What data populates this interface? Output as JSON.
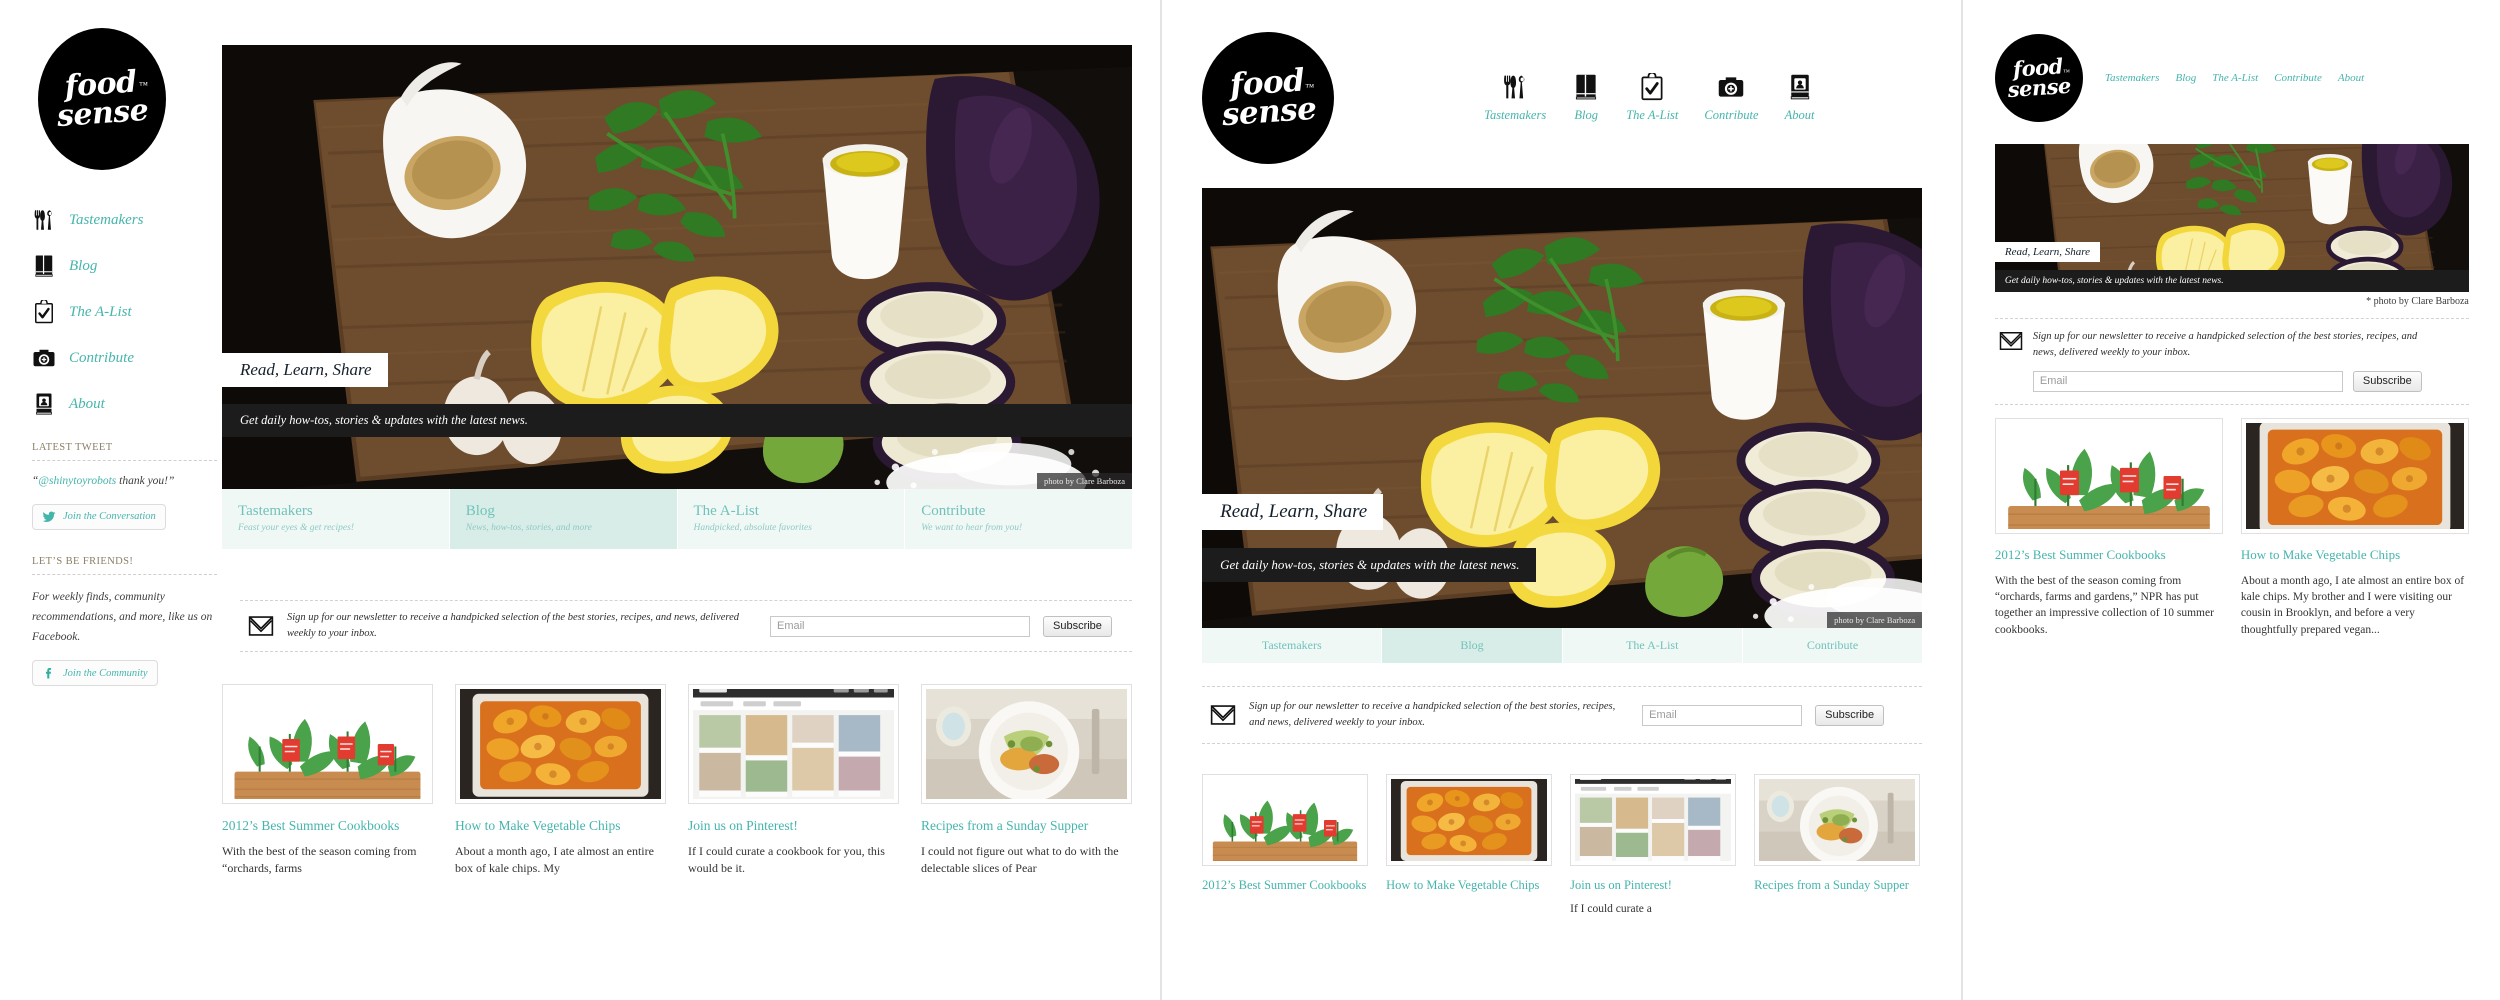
{
  "brand": {
    "line1": "food",
    "line2": "sense",
    "tm": "™"
  },
  "nav": {
    "items": [
      {
        "label": "Tastemakers",
        "icon": "utensils-icon"
      },
      {
        "label": "Blog",
        "icon": "book-icon"
      },
      {
        "label": "The A-List",
        "icon": "clipboard-check-icon"
      },
      {
        "label": "Contribute",
        "icon": "camera-icon"
      },
      {
        "label": "About",
        "icon": "profile-book-icon"
      }
    ]
  },
  "sidebar": {
    "tweet_heading": "LATEST TWEET",
    "tweet_handle": "@shinytoyrobots",
    "tweet_text_before": "“",
    "tweet_text_after": " thank you!”",
    "tweet_button": "Join the Conversation",
    "friends_heading": "LET’S BE FRIENDS!",
    "friends_text": "For weekly finds, community recommendations, and more, like us on Facebook.",
    "friends_button": "Join the Community"
  },
  "hero": {
    "title": "Read, Learn, Share",
    "subtitle": "Get daily how-tos, stories & updates with the latest news.",
    "credit_inset": "photo by Clare Barboza",
    "credit_line": "* photo by Clare Barboza"
  },
  "tabs": [
    {
      "title": "Tastemakers",
      "sub": "Feast your eyes & get recipes!",
      "active": false
    },
    {
      "title": "Blog",
      "sub": "News, how-tos, stories, and more",
      "active": true
    },
    {
      "title": "The A-List",
      "sub": "Handpicked, absolute favorites",
      "active": false
    },
    {
      "title": "Contribute",
      "sub": "We want to hear from you!",
      "active": false
    }
  ],
  "newsletter": {
    "text_desktop": "Sign up for our newsletter to receive a handpicked selection of the best stories, recipes, and news, delivered weekly to your inbox.",
    "text_tablet": "Sign up for our newsletter to receive a handpicked selection of the best stories, recipes, and news, delivered weekly to your inbox.",
    "text_mobile": "Sign up for our newsletter to receive a handpicked selection of the best stories, recipes, and news, delivered weekly to your inbox.",
    "placeholder": "Email",
    "button": "Subscribe",
    "icon": "envelope-icon"
  },
  "cards": [
    {
      "title": "2012’s Best Summer Cookbooks",
      "excerpt_short": "With the best of the season coming from “orchards, farms",
      "excerpt_long": "With the best of the season coming from “orchards, farms and gardens,” NPR has put together an impressive collection of 10 summer cookbooks.",
      "thumb": "kale-illustration"
    },
    {
      "title": "How to Make Vegetable Chips",
      "excerpt_short": "About a month ago, I ate almost an entire box of kale chips. My",
      "excerpt_long": "About a month ago, I ate almost an entire box of kale chips. My brother and I were visiting our cousin in Brooklyn, and before a very thoughtfully prepared vegan...",
      "thumb": "sweet-potato-chips-photo"
    },
    {
      "title": "Join us on Pinterest!",
      "excerpt_short": "If I could curate a cookbook for you, this would be it.",
      "excerpt_long": "If I could curate a",
      "thumb": "pinterest-board-screenshot"
    },
    {
      "title": "Recipes from a Sunday Supper",
      "excerpt_short": "I could not figure out what to do with the delectable slices of Pear",
      "excerpt_long": "I could not figure out what to do with the delectable slices of Pear",
      "thumb": "sunday-supper-plate-photo"
    }
  ],
  "colors": {
    "accent": "#45b5ac",
    "tab_bg": "#f0f8f6",
    "tab_active_bg": "#d9ede8",
    "tab_text": "#72c2bb",
    "heading": "#8a7f66",
    "dark": "#1c1c1c"
  }
}
